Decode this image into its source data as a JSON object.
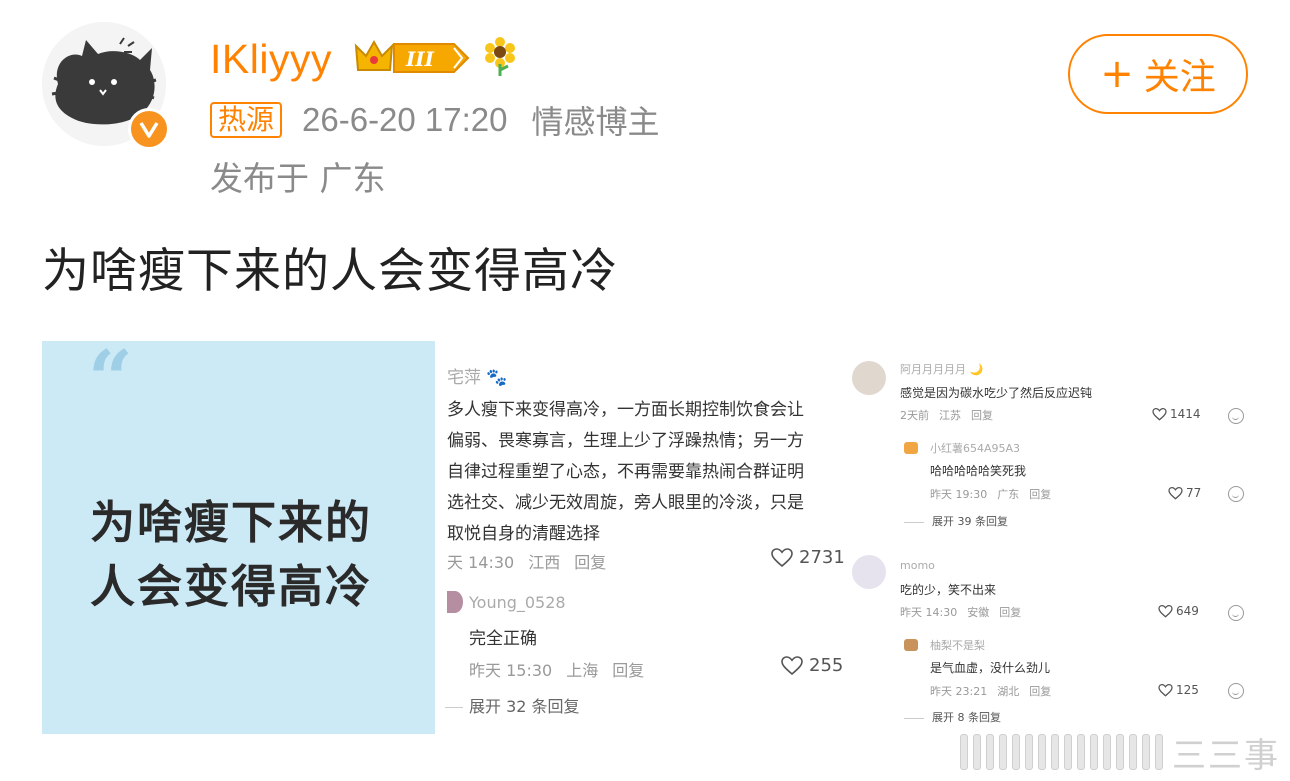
{
  "header": {
    "username": "IKliyyy",
    "vip_level": "III",
    "hot_badge": "热源",
    "post_time": "26-6-20 17:20",
    "user_tag": "情感博主",
    "location": "发布于 广东",
    "follow_button": {
      "plus": "+",
      "label": "关注"
    }
  },
  "post": {
    "text": "为啥瘦下来的人会变得高冷"
  },
  "images": {
    "card1": {
      "quote": "“",
      "title_line1": "为啥瘦下来的",
      "title_line2": "人会变得高冷"
    },
    "card2": {
      "author": "宅萍",
      "text_lines": [
        "多人瘦下来变得高冷，一方面长期控制饮食会让",
        "偏弱、畏寒寡言，生理上少了浮躁热情；另一方",
        "自律过程重塑了心态，不再需要靠热闹合群证明",
        "选社交、减少无效周旋，旁人眼里的冷淡，只是",
        "取悦自身的清醒选择"
      ],
      "time": "天 14:30",
      "region": "江西",
      "reply": "回复",
      "likes": "2731",
      "sub": {
        "author": "Young_0528",
        "text": "完全正确",
        "time": "昨天 15:30",
        "region": "上海",
        "reply": "回复",
        "likes": "255"
      },
      "expand": "展开 32 条回复"
    },
    "card3": {
      "comments": [
        {
          "author": "阿月月月月月",
          "text": "感觉是因为碳水吃少了然后反应迟钝",
          "time": "2天前",
          "region": "江苏",
          "reply": "回复",
          "likes": "1414"
        },
        {
          "author": "小红薯654A95A3",
          "text": "哈哈哈哈哈笑死我",
          "time": "昨天 19:30",
          "region": "广东",
          "reply": "回复",
          "likes": "77"
        },
        {
          "author": "momo",
          "text": "吃的少，笑不出来",
          "time": "昨天 14:30",
          "region": "安徽",
          "reply": "回复",
          "likes": "649"
        },
        {
          "author": "柚梨不是梨",
          "text": "是气血虚，没什么劲儿",
          "time": "昨天 23:21",
          "region": "湖北",
          "reply": "回复",
          "likes": "125"
        }
      ],
      "expand1": "展开 39 条回复",
      "expand2": "展开 8 条回复"
    }
  },
  "watermark": {
    "text": "三三事"
  },
  "colors": {
    "brand_orange": "#ff8200",
    "card_blue": "#cce9f6",
    "meta_gray": "#8a8a8a"
  },
  "icons": [
    "cat-avatar",
    "verified-v-icon",
    "crown-icon",
    "sunflower-icon",
    "heart-icon",
    "smile-icon"
  ]
}
